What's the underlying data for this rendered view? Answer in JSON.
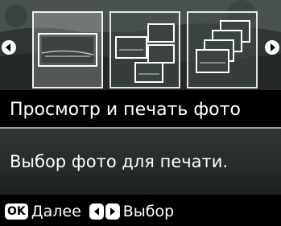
{
  "carousel": {
    "items": [
      {
        "icon": "single-photo-icon",
        "selected": true
      },
      {
        "icon": "multi-photo-icon",
        "selected": false
      },
      {
        "icon": "photo-stack-icon",
        "selected": false
      }
    ]
  },
  "title": "Просмотр и печать фото",
  "description": "Выбор фото для печати.",
  "footer": {
    "ok_label": "OK",
    "next_label": "Далее",
    "select_label": "Выбор"
  },
  "colors": {
    "background": "#000000",
    "text": "#ffffff",
    "tile_border": "#e6e6e6"
  }
}
